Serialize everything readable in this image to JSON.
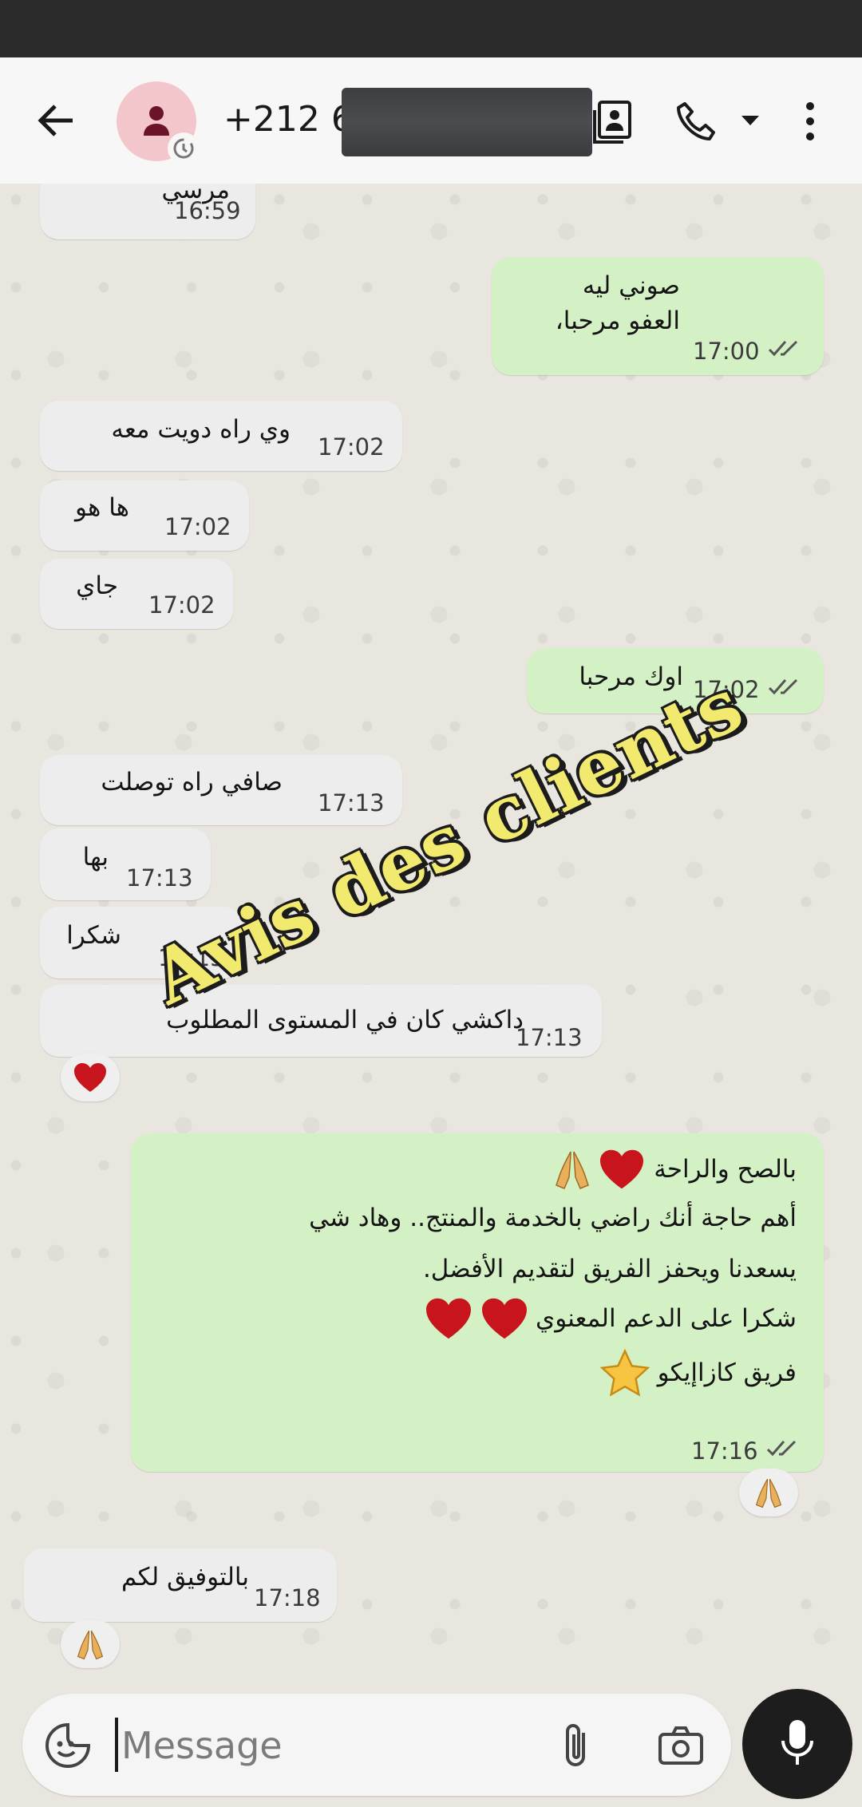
{
  "header": {
    "phone_prefix": "+212 6",
    "icons": [
      "back-arrow-icon",
      "person-icon",
      "status-timer-icon",
      "contact-card-icon",
      "phone-icon",
      "dropdown-caret-icon",
      "more-vert-icon"
    ]
  },
  "messages": [
    {
      "dir": "in",
      "text": "مرسي",
      "time": "16:59"
    },
    {
      "dir": "out",
      "text": "صوني ليه\nالعفو مرحبا،",
      "time": "17:00"
    },
    {
      "dir": "in",
      "text": "وي راه دويت معه",
      "time": "17:02"
    },
    {
      "dir": "in",
      "text": "ها هو",
      "time": "17:02"
    },
    {
      "dir": "in",
      "text": "جاي",
      "time": "17:02"
    },
    {
      "dir": "out",
      "text": "اوك مرحبا",
      "time": "17:02"
    },
    {
      "dir": "in",
      "text": "صافي راه توصلت",
      "time": "17:13"
    },
    {
      "dir": "in",
      "text": "بها",
      "time": "17:13"
    },
    {
      "dir": "in",
      "text": "شكرا",
      "time": "17:13"
    },
    {
      "dir": "in",
      "text": "داكشي كان في المستوى المطلوب",
      "time": "17:13"
    },
    {
      "dir": "out",
      "lines": [
        "بالصح والراحة",
        "أهم حاجة أنك راضي بالخدمة والمنتج.. وهاد شي",
        "يسعدنا ويحفز الفريق لتقديم الأفضل.",
        "شكرا على الدعم المعنوي",
        "فريق كازاإيكو"
      ],
      "time": "17:16"
    },
    {
      "dir": "in",
      "text": "بالتوفيق لكم",
      "time": "17:18"
    }
  ],
  "watermark": "Avis des clients",
  "composer": {
    "placeholder": "Message"
  },
  "colors": {
    "incoming": "#ededed",
    "outgoing": "#d4f1c6",
    "ticks": "#555555",
    "heart": "#c8141c"
  }
}
